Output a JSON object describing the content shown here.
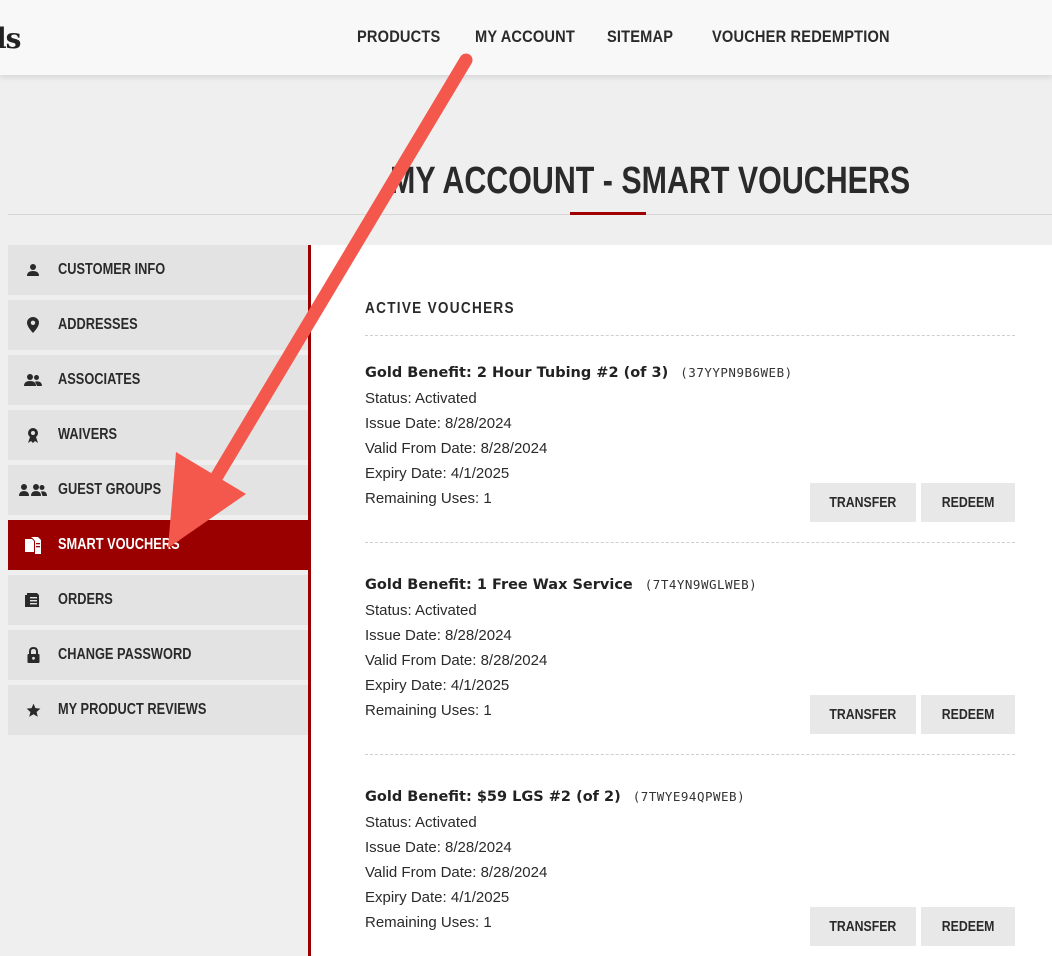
{
  "header": {
    "logo_fragment": "ls",
    "nav": [
      {
        "label": "PRODUCTS"
      },
      {
        "label": "MY ACCOUNT"
      },
      {
        "label": "SITEMAP"
      },
      {
        "label": "VOUCHER REDEMPTION"
      }
    ]
  },
  "page": {
    "title": "MY ACCOUNT - SMART VOUCHERS",
    "accent_color": "#a00000"
  },
  "sidebar": {
    "items": [
      {
        "label": "CUSTOMER INFO",
        "icon": "person-icon",
        "active": false
      },
      {
        "label": "ADDRESSES",
        "icon": "map-pin-icon",
        "active": false
      },
      {
        "label": "ASSOCIATES",
        "icon": "people-icon",
        "active": false
      },
      {
        "label": "WAIVERS",
        "icon": "ribbon-icon",
        "active": false
      },
      {
        "label": "GUEST GROUPS",
        "icon": "group-icon",
        "active": false
      },
      {
        "label": "SMART VOUCHERS",
        "icon": "documents-icon",
        "active": true
      },
      {
        "label": "ORDERS",
        "icon": "orders-icon",
        "active": false
      },
      {
        "label": "CHANGE PASSWORD",
        "icon": "lock-icon",
        "active": false
      },
      {
        "label": "MY PRODUCT REVIEWS",
        "icon": "star-icon",
        "active": false
      }
    ]
  },
  "content": {
    "section_title": "ACTIVE VOUCHERS",
    "vouchers": [
      {
        "name": "Gold Benefit: 2 Hour Tubing #2 (of 3)",
        "code": "(37YYPN9B6WEB)",
        "status": "Status: Activated",
        "issue_date": "Issue Date: 8/28/2024",
        "valid_from": "Valid From Date: 8/28/2024",
        "expiry": "Expiry Date: 4/1/2025",
        "remaining": "Remaining Uses: 1",
        "transfer_label": "TRANSFER",
        "redeem_label": "REDEEM"
      },
      {
        "name": "Gold Benefit: 1 Free Wax Service",
        "code": "(7T4YN9WGLWEB)",
        "status": "Status: Activated",
        "issue_date": "Issue Date: 8/28/2024",
        "valid_from": "Valid From Date: 8/28/2024",
        "expiry": "Expiry Date: 4/1/2025",
        "remaining": "Remaining Uses: 1",
        "transfer_label": "TRANSFER",
        "redeem_label": "REDEEM"
      },
      {
        "name": "Gold Benefit: $59 LGS #2 (of 2)",
        "code": "(7TWYE94QPWEB)",
        "status": "Status: Activated",
        "issue_date": "Issue Date: 8/28/2024",
        "valid_from": "Valid From Date: 8/28/2024",
        "expiry": "Expiry Date: 4/1/2025",
        "remaining": "Remaining Uses: 1",
        "transfer_label": "TRANSFER",
        "redeem_label": "REDEEM"
      }
    ]
  },
  "annotation": {
    "arrow_color": "#f4574b"
  }
}
